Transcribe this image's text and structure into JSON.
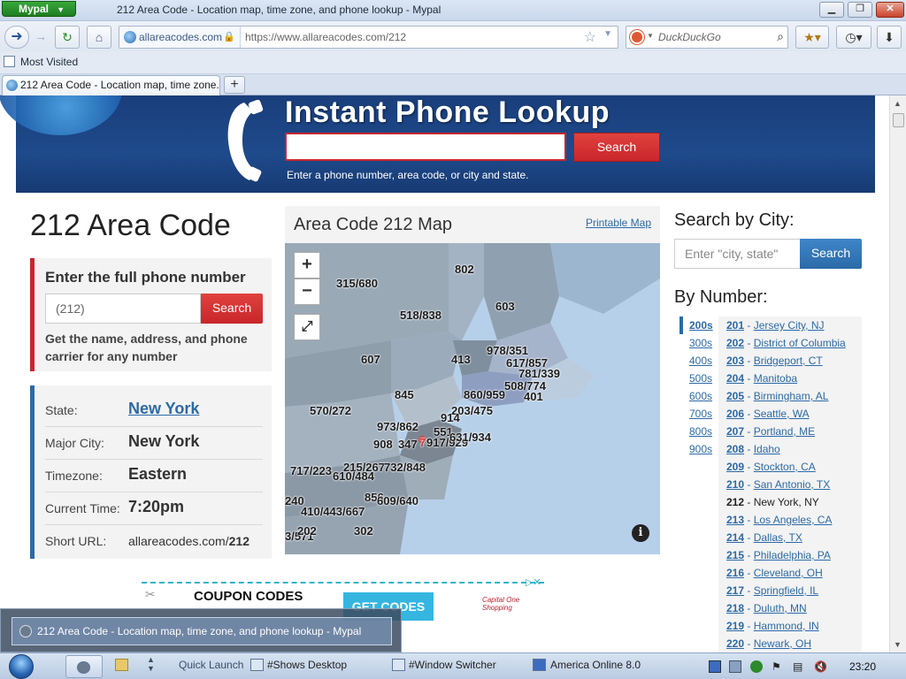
{
  "browser": {
    "app_button": "Mypal",
    "window_title": "212 Area Code - Location map, time zone, and phone lookup - Mypal",
    "site_identity": "allareacodes.com",
    "url": "https://www.allareacodes.com/212",
    "search_placeholder": "DuckDuckGo",
    "bookmark": "Most Visited",
    "tab_title": "212 Area Code - Location map, time zone...",
    "new_tab": "+",
    "minimize": "▁",
    "maximize": "❐",
    "close": "✕"
  },
  "header": {
    "title": "Instant Phone Lookup",
    "search_button": "Search",
    "hint": "Enter a phone number, area code, or city and state."
  },
  "page_title": "212 Area Code",
  "enter_box": {
    "title": "Enter the full phone number",
    "input_value": "(212)",
    "search_button": "Search",
    "description": "Get the name, address, and phone carrier for any number"
  },
  "info": {
    "state_label": "State:",
    "state_value": "New York",
    "city_label": "Major City:",
    "city_value": "New York",
    "timezone_label": "Timezone:",
    "timezone_value": "Eastern",
    "time_label": "Current Time:",
    "time_value": "7:20pm",
    "short_label": "Short URL:",
    "short_value_prefix": "allareacodes.com/",
    "short_value_code": "212"
  },
  "map": {
    "title": "Area Code 212 Map",
    "printable": "Printable Map",
    "zoom_in": "+",
    "zoom_out": "−",
    "info": "i",
    "labels": [
      "315/680",
      "802",
      "518/838",
      "603",
      "978/351",
      "617/857",
      "413",
      "607",
      "781/339",
      "508/774",
      "845",
      "860/959",
      "401",
      "570/272",
      "203/475",
      "914",
      "973/862",
      "551",
      "908",
      "347",
      "7",
      "917/929",
      "631/934",
      "717/223",
      "215/267",
      "732/848",
      "610/484",
      "856",
      "609/640",
      "240",
      "410/443/667",
      "302",
      "3/571",
      "202"
    ]
  },
  "city_search": {
    "title": "Search by City:",
    "placeholder": "Enter \"city, state\"",
    "button": "Search"
  },
  "by_number": {
    "title": "By Number:",
    "ranges": [
      "200s",
      "300s",
      "400s",
      "500s",
      "600s",
      "700s",
      "800s",
      "900s"
    ],
    "codes": [
      {
        "num": "201",
        "city": "Jersey City, NJ"
      },
      {
        "num": "202",
        "city": "District of Columbia"
      },
      {
        "num": "203",
        "city": "Bridgeport, CT"
      },
      {
        "num": "204",
        "city": "Manitoba"
      },
      {
        "num": "205",
        "city": "Birmingham, AL"
      },
      {
        "num": "206",
        "city": "Seattle, WA"
      },
      {
        "num": "207",
        "city": "Portland, ME"
      },
      {
        "num": "208",
        "city": "Idaho"
      },
      {
        "num": "209",
        "city": "Stockton, CA"
      },
      {
        "num": "210",
        "city": "San Antonio, TX"
      },
      {
        "num": "212",
        "city": "New York, NY"
      },
      {
        "num": "213",
        "city": "Los Angeles, CA"
      },
      {
        "num": "214",
        "city": "Dallas, TX"
      },
      {
        "num": "215",
        "city": "Philadelphia, PA"
      },
      {
        "num": "216",
        "city": "Cleveland, OH"
      },
      {
        "num": "217",
        "city": "Springfield, IL"
      },
      {
        "num": "218",
        "city": "Duluth, MN"
      },
      {
        "num": "219",
        "city": "Hammond, IN"
      },
      {
        "num": "220",
        "city": "Newark, OH"
      }
    ]
  },
  "ad": {
    "coupon": "COUPON CODES",
    "button": "GET CODES",
    "brand": "Capital One Shopping"
  },
  "taskbar": {
    "preview_title": "212 Area Code - Location map, time zone, and phone lookup - Mypal",
    "quick_launch": "Quick Launch",
    "shows_desktop": "#Shows Desktop",
    "window_switcher": "#Window Switcher",
    "aol": "America Online 8.0",
    "clock": "23:20"
  },
  "colors": {
    "header_blue": "#1e4a8c",
    "red_accent": "#c9262d",
    "link_blue": "#2c6aa8"
  }
}
